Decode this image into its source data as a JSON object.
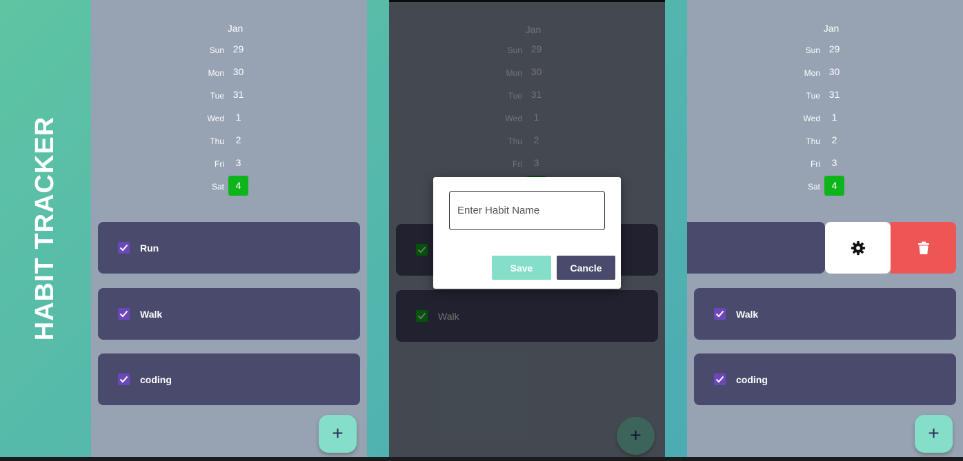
{
  "app": {
    "title": "HABIT TRACKER"
  },
  "calendar": {
    "month": "Jan",
    "days": [
      {
        "name": "Sun",
        "num": "29"
      },
      {
        "name": "Mon",
        "num": "30"
      },
      {
        "name": "Tue",
        "num": "31"
      },
      {
        "name": "Wed",
        "num": "1"
      },
      {
        "name": "Thu",
        "num": "2"
      },
      {
        "name": "Fri",
        "num": "3"
      },
      {
        "name": "Sat",
        "num": "4"
      }
    ],
    "selected_day": "4"
  },
  "habits": [
    {
      "label": "Run",
      "checked": true
    },
    {
      "label": "Walk",
      "checked": true
    },
    {
      "label": "coding",
      "checked": true
    }
  ],
  "fab": {
    "label": "+"
  },
  "dialog": {
    "placeholder": "Enter Habit Name",
    "save_label": "Save",
    "cancel_label": "Cancle"
  },
  "swipe_actions": {
    "settings_icon": "gear-icon",
    "delete_icon": "trash-icon"
  },
  "colors": {
    "background_start": "#5ec4a2",
    "panel": "#97a3b3",
    "card": "#4a4a6c",
    "checkbox": "#6b48ba",
    "selected_day": "#0db51a",
    "fab": "#85dec7",
    "delete": "#ee5555"
  }
}
